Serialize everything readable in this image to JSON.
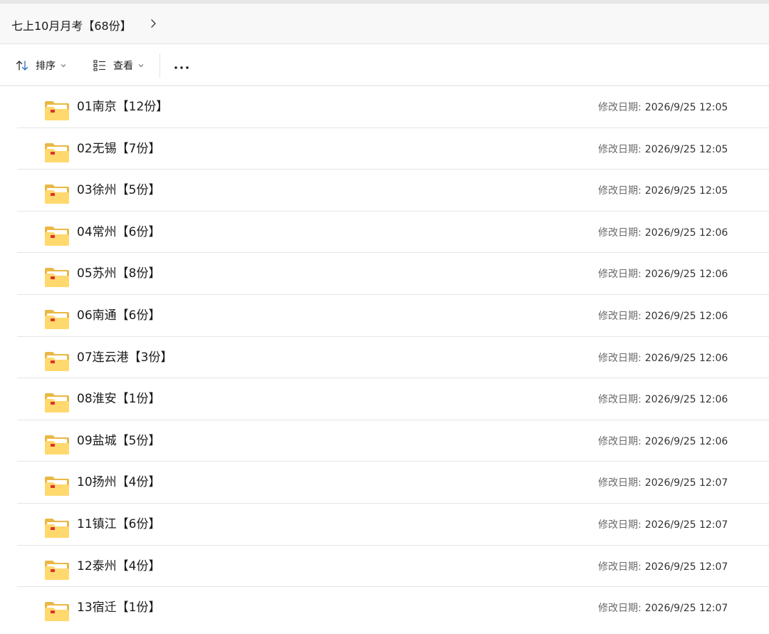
{
  "breadcrumb": {
    "path": "七上10月月考【68份】",
    "chevron_icon": "chevron-right-icon"
  },
  "toolbar": {
    "sort_label": "排序",
    "view_label": "查看",
    "sort_icon": "sort-arrows-icon",
    "view_icon": "list-view-icon",
    "more_icon": "more-dots-icon"
  },
  "list": {
    "date_label": "修改日期:",
    "folder_icon": "folder-icon",
    "colors": {
      "folder_back": "#e9b845",
      "folder_front": "#ffd86e",
      "folder_paper": "#ffffff",
      "badge": "#d9342b"
    },
    "items": [
      {
        "name": "01南京【12份】",
        "modified": "2026/9/25 12:05"
      },
      {
        "name": "02无锡【7份】",
        "modified": "2026/9/25 12:05"
      },
      {
        "name": "03徐州【5份】",
        "modified": "2026/9/25 12:05"
      },
      {
        "name": "04常州【6份】",
        "modified": "2026/9/25 12:06"
      },
      {
        "name": "05苏州【8份】",
        "modified": "2026/9/25 12:06"
      },
      {
        "name": "06南通【6份】",
        "modified": "2026/9/25 12:06"
      },
      {
        "name": "07连云港【3份】",
        "modified": "2026/9/25 12:06"
      },
      {
        "name": "08淮安【1份】",
        "modified": "2026/9/25 12:06"
      },
      {
        "name": "09盐城【5份】",
        "modified": "2026/9/25 12:06"
      },
      {
        "name": "10扬州【4份】",
        "modified": "2026/9/25 12:07"
      },
      {
        "name": "11镇江【6份】",
        "modified": "2026/9/25 12:07"
      },
      {
        "name": "12泰州【4份】",
        "modified": "2026/9/25 12:07"
      },
      {
        "name": "13宿迁【1份】",
        "modified": "2026/9/25 12:07"
      }
    ]
  }
}
